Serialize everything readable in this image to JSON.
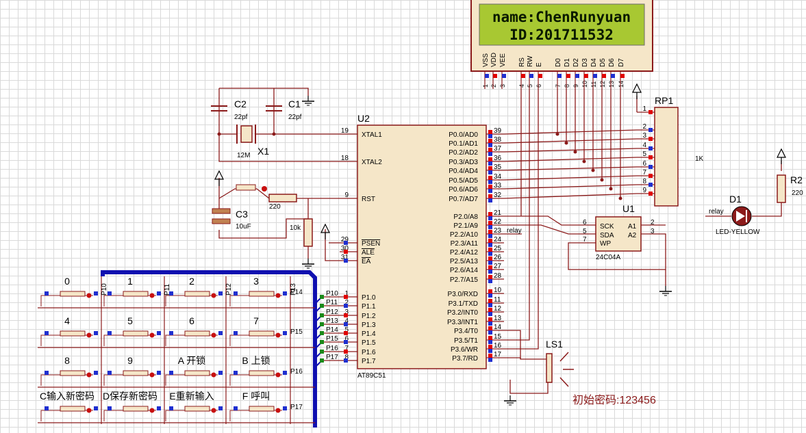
{
  "lcd": {
    "line1": "name:ChenRunyuan",
    "line2": "ID:201711532",
    "pins": [
      "VSS",
      "VDD",
      "VEE",
      "RS",
      "RW",
      "E",
      "D0",
      "D1",
      "D2",
      "D3",
      "D4",
      "D5",
      "D6",
      "D7"
    ],
    "pin_numbers": [
      "1",
      "2",
      "3",
      "4",
      "5",
      "6",
      "7",
      "8",
      "9",
      "10",
      "11",
      "12",
      "13",
      "14"
    ]
  },
  "crystal": {
    "c2": "C2",
    "c2_val": "22pf",
    "c1": "C1",
    "c1_val": "22pf",
    "x1": "X1",
    "x1_val": "12M"
  },
  "reset": {
    "c3": "C3",
    "c3_val": "10uF",
    "r220": "220",
    "r10k": "10k"
  },
  "mcu": {
    "ref": "U2",
    "part": "AT89C51",
    "left_pins": [
      {
        "num": "19",
        "name": "XTAL1"
      },
      {
        "num": "18",
        "name": "XTAL2"
      },
      {
        "num": "9",
        "name": "RST"
      },
      {
        "num": "29",
        "name": "PSEN"
      },
      {
        "num": "30",
        "name": "ALE"
      },
      {
        "num": "31",
        "name": "EA"
      },
      {
        "num": "1",
        "name": "P1.0"
      },
      {
        "num": "2",
        "name": "P1.1"
      },
      {
        "num": "3",
        "name": "P1.2"
      },
      {
        "num": "4",
        "name": "P1.3"
      },
      {
        "num": "5",
        "name": "P1.4"
      },
      {
        "num": "6",
        "name": "P1.5"
      },
      {
        "num": "7",
        "name": "P1.6"
      },
      {
        "num": "8",
        "name": "P1.7"
      }
    ],
    "right_pins": [
      {
        "num": "39",
        "name": "P0.0/AD0"
      },
      {
        "num": "38",
        "name": "P0.1/AD1"
      },
      {
        "num": "37",
        "name": "P0.2/AD2"
      },
      {
        "num": "36",
        "name": "P0.3/AD3"
      },
      {
        "num": "35",
        "name": "P0.4/AD4"
      },
      {
        "num": "34",
        "name": "P0.5/AD5"
      },
      {
        "num": "33",
        "name": "P0.6/AD6"
      },
      {
        "num": "32",
        "name": "P0.7/AD7"
      },
      {
        "num": "21",
        "name": "P2.0/A8"
      },
      {
        "num": "22",
        "name": "P2.1/A9"
      },
      {
        "num": "23",
        "name": "P2.2/A10"
      },
      {
        "num": "24",
        "name": "P2.3/A11"
      },
      {
        "num": "25",
        "name": "P2.4/A12"
      },
      {
        "num": "26",
        "name": "P2.5/A13"
      },
      {
        "num": "27",
        "name": "P2.6/A14"
      },
      {
        "num": "28",
        "name": "P2.7/A15"
      },
      {
        "num": "10",
        "name": "P3.0/RXD"
      },
      {
        "num": "11",
        "name": "P3.1/TXD"
      },
      {
        "num": "12",
        "name": "P3.2/INT0"
      },
      {
        "num": "13",
        "name": "P3.3/INT1"
      },
      {
        "num": "14",
        "name": "P3.4/T0"
      },
      {
        "num": "15",
        "name": "P3.5/T1"
      },
      {
        "num": "16",
        "name": "P3.6/WR"
      },
      {
        "num": "17",
        "name": "P3.7/RD"
      }
    ],
    "p1_nets": [
      "P10",
      "P11",
      "P12",
      "P13",
      "P14",
      "P15",
      "P16",
      "P17"
    ],
    "relay_net": "relay"
  },
  "rp1": {
    "ref": "RP1",
    "value": "1K",
    "pins": [
      "1",
      "2",
      "3",
      "4",
      "5",
      "6",
      "7",
      "8",
      "9"
    ]
  },
  "eeprom": {
    "ref": "U1",
    "part": "24C04A",
    "pins": [
      {
        "num": "6",
        "name": "SCK"
      },
      {
        "num": "5",
        "name": "SDA"
      },
      {
        "num": "7",
        "name": "WP"
      },
      {
        "num": "2",
        "name": "A1"
      },
      {
        "num": "3",
        "name": "A2"
      }
    ]
  },
  "led": {
    "ref": "D1",
    "part": "LED-YELLOW",
    "net": "relay",
    "r_ref": "R2",
    "r_val": "220"
  },
  "buzzer": {
    "ref": "LS1"
  },
  "keypad": {
    "keys": [
      "0",
      "1",
      "2",
      "3",
      "4",
      "5",
      "6",
      "7",
      "8",
      "9",
      "A",
      "B",
      "C",
      "D",
      "E",
      "F"
    ],
    "key_texts": [
      "0",
      "1",
      "2",
      "3",
      "4",
      "5",
      "6",
      "7",
      "8",
      "9",
      "A 开锁",
      "B 上锁",
      "C输入新密码",
      "D保存新密码",
      "E重新输入",
      "F 呼叫"
    ],
    "col_nets": [
      "P10",
      "P11",
      "P12",
      "P13"
    ],
    "row_nets": [
      "P14",
      "P15",
      "P16",
      "P17"
    ]
  },
  "note": "初始密码:123456",
  "colors": {
    "wire": "#8b1a1a",
    "component": "#8b1a1a",
    "component_fill": "#f5e6c8",
    "lcd_green": "#a8c832",
    "bus": "#1010b0",
    "pin_red": "#e00000",
    "pin_blue": "#1f2fd0"
  }
}
